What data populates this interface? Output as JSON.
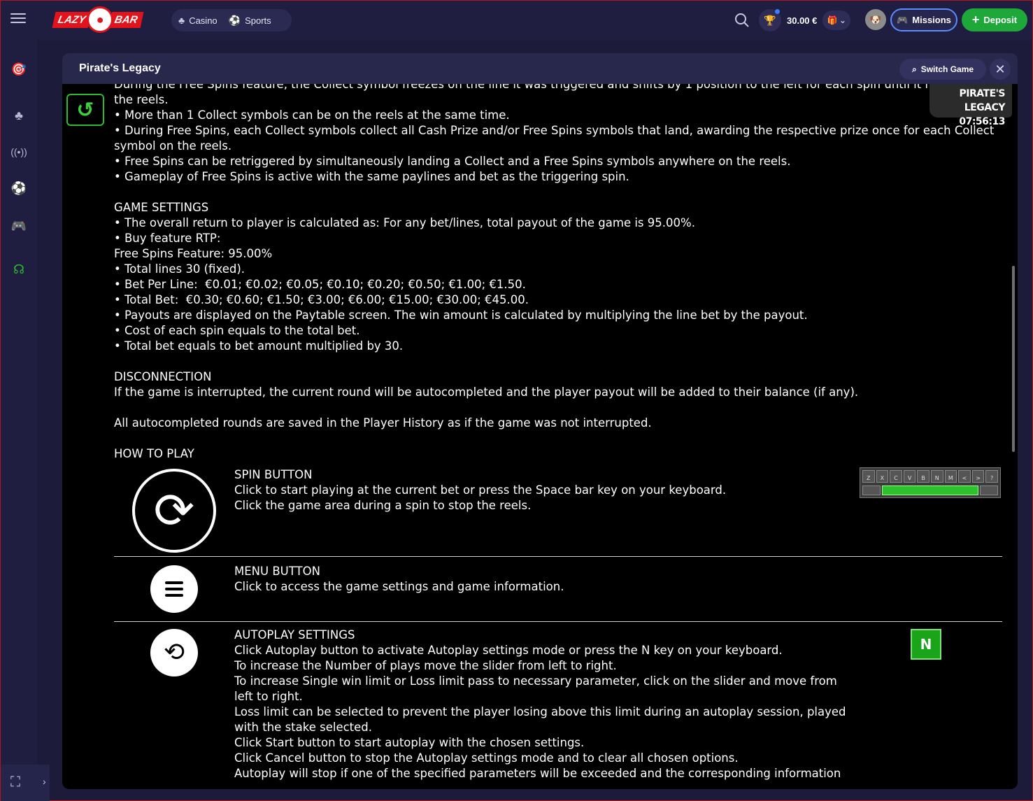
{
  "header": {
    "logo_left": "LAZY",
    "logo_right": "BAR",
    "nav": [
      {
        "label": "Casino",
        "icon": "cherries-icon"
      },
      {
        "label": "Sports",
        "icon": "football-icon"
      }
    ],
    "balance": "30.00 €",
    "missions_label": "Missions",
    "deposit_label": "Deposit",
    "deposit_color": "#1fa83a",
    "missions_border_color": "#5b8dff"
  },
  "sidebar": {
    "items": [
      "darts-icon",
      "cherries-icon",
      "live-icon",
      "football-icon",
      "gamepad-icon",
      "support-icon"
    ]
  },
  "panel": {
    "title": "Pirate's Legacy",
    "switch_label": "Switch Game",
    "stamp_title": "PIRATE'S LEGACY",
    "stamp_time": "07:56:13"
  },
  "rules": {
    "intro": [
      "During the Free Spins feature, the Collect symbol freezes on the line it was triggered and shifts by 1 position to the left for each spin until it moves",
      "the reels.",
      "• More than 1 Collect symbols can be on the reels at the same time.",
      "• During Free Spins, each Collect symbols collect all Cash Prize and/or Free Spins symbols that land, awarding the respective prize once for each Collect symbol on the reels.",
      "• Free Spins can be retriggered by simultaneously landing a Collect and a Free Spins symbols anywhere on the reels.",
      "• Gameplay of Free Spins is active with the same paylines and bet as the triggering spin."
    ],
    "game_settings_title": "GAME SETTINGS",
    "game_settings": [
      "• The overall return to player is calculated as: For any bet/lines, total payout of the game is 95.00%.",
      "• Buy feature RTP:",
      "Free Spins Feature: 95.00%",
      "• Total lines 30 (fixed).",
      "• Bet Per Line:  €0.01; €0.02; €0.05; €0.10; €0.20; €0.50; €1.00; €1.50.",
      "• Total Bet:  €0.30; €0.60; €1.50; €3.00; €6.00; €15.00; €30.00; €45.00.",
      "• Payouts are displayed on the Paytable screen. The win amount is calculated by multiplying the line bet by the payout.",
      "• Cost of each spin equals to the total bet.",
      "• Total bet equals to bet amount multiplied by 30."
    ],
    "disconnection_title": "DISCONNECTION",
    "disconnection": [
      "If the game is interrupted, the current round will be autocompleted and the player payout will be added to their balance (if any).",
      "",
      "All autocompleted rounds are saved in the Player History as if the game was not interrupted."
    ],
    "how_to_play_title": "HOW TO PLAY",
    "spin_title": "SPIN BUTTON",
    "spin_lines": [
      "Click to start playing at the current bet or press the Space bar key on your keyboard.",
      "Click the game area during a spin to stop the reels."
    ],
    "menu_title": "MENU BUTTON",
    "menu_lines": [
      "Click to access the game settings and game information."
    ],
    "autoplay_title": "AUTOPLAY SETTINGS",
    "autoplay_lines": [
      "Click Autoplay button to activate Autoplay settings mode or press the N key on your keyboard.",
      "To increase the Number of plays move the slider from left to right.",
      "To increase Single win limit or Loss limit pass to necessary parameter, click on the slider and move from left to right.",
      "Loss limit can be selected to prevent the player losing above this limit during an autoplay session, played with the stake selected.",
      "Click Start button to start autoplay with the chosen settings.",
      "Click Cancel button to stop the Autoplay settings mode and to clear all chosen options.",
      "Autoplay will stop if one of the specified parameters will be exceeded and the corresponding information"
    ],
    "keyboard_keys": [
      "Z",
      "X",
      "C",
      "V",
      "B",
      "N",
      "M",
      "<",
      ">",
      "?"
    ],
    "n_key": "N"
  }
}
